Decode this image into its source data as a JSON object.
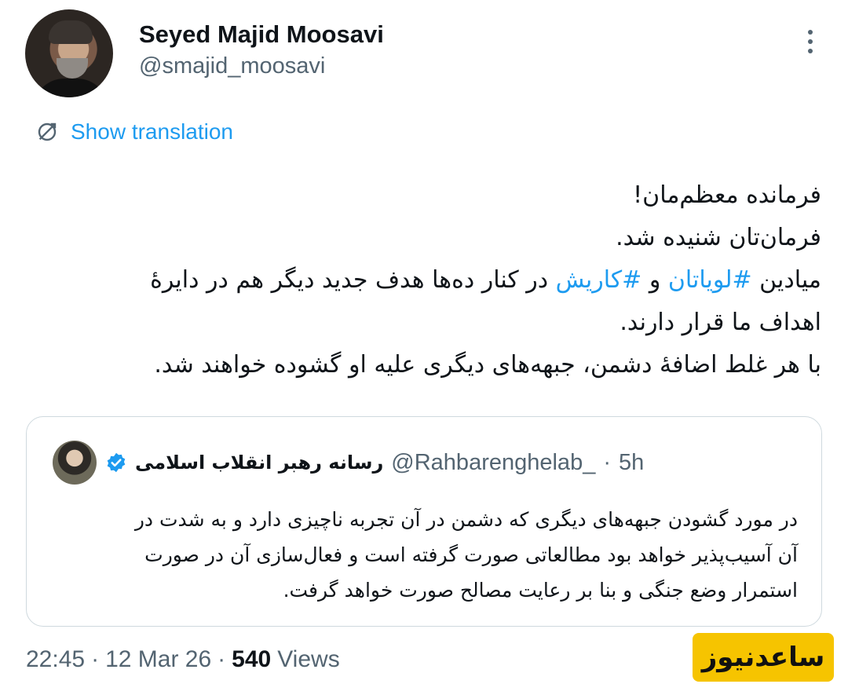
{
  "author": {
    "name": "Seyed Majid Moosavi",
    "handle": "@smajid_moosavi",
    "avatar_icon": "profile-photo"
  },
  "translate": {
    "label": "Show translation",
    "icon": "translate-icon"
  },
  "tweet": {
    "lines": [
      {
        "text": "فرمانده معظم‌مان!"
      },
      {
        "text": "فرمان‌تان شنیده شد."
      },
      {
        "pre": "میادین ",
        "tag1": "#لویاتان",
        "mid": " و ",
        "tag2": "#کاریش",
        "post": " در کنار ده‌ها هدف جدید دیگر هم در دایرهٔ"
      },
      {
        "text": "اهداف ما قرار دارند."
      },
      {
        "text": "با هر غلط اضافهٔ دشمن، جبهه‌های دیگری علیه او گشوده خواهند شد."
      }
    ]
  },
  "quote": {
    "name": "رسانه رهبر انقلاب اسلامی",
    "handle": "@Rahbarenghelab_",
    "separator": "·",
    "time": "5h",
    "verified_icon": "verified-badge-icon",
    "lines": [
      "در مورد گشودن جبهه‌های دیگری که دشمن در آن تجربه ناچیزی دارد و به شدت در",
      "آن آسیب‌پذیر خواهد بود مطالعاتی صورت گرفته است و فعال‌سازی آن در صورت",
      "استمرار وضع جنگی و بنا بر رعایت مصالح صورت خواهد گرفت."
    ]
  },
  "meta": {
    "time": "22:45",
    "sep1": "·",
    "date": "12 Mar 26",
    "sep2": "·",
    "views_count": "540",
    "views_label": "Views"
  },
  "watermark": {
    "text": "ساعدنیوز"
  },
  "colors": {
    "link": "#1d9bf0",
    "secondary": "#536471",
    "primary_text": "#0f1419",
    "border": "#cfd9de",
    "watermark_bg": "#f6c400"
  }
}
